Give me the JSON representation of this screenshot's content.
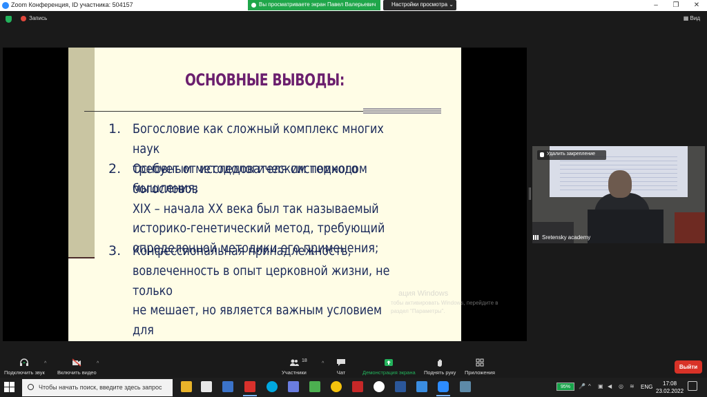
{
  "window": {
    "title": "Zoom Конференция, ID участника: 504157",
    "share_banner": "Вы просматриваете экран Павел Валерьевич",
    "view_options": "Настройки просмотра ⌄",
    "controls": {
      "minimize": "–",
      "restore": "❐",
      "close": "✕"
    }
  },
  "meeting": {
    "recording_label": "Запись",
    "view_label": "Вид"
  },
  "slide": {
    "title": "ОСНОВНЫЕ ВЫВОДЫ:",
    "items": [
      {
        "num": "1.",
        "text": "Богословие как сложный комплекс многих наук\nтребует от исследователя системного мышления;"
      },
      {
        "num": "2.",
        "text": "Основным методологическим подходом богословов\nXIX – начала XX века был так называемый\nисторико-генетический метод, требующий\nопределенной методики его применения;"
      },
      {
        "num": "3.",
        "text": "Конфессиональная принадлежность,\nвовлеченность в опыт церковной жизни, не только\nне мешает, но является важным условием для\nполучения объективных научных результатов."
      }
    ]
  },
  "watermark": {
    "line1": "ация Windows",
    "line2": "тобы активировать Windows, перейдите в\nраздел \"Параметры\"."
  },
  "speaker": {
    "unpin_label": "Удалить закрепление",
    "name": "Sretensky academy"
  },
  "toolbar": {
    "mute": "Подключить звук",
    "video": "Включить видео",
    "participants": "Участники",
    "participants_count": "18",
    "chat": "Чат",
    "share": "Демонстрация экрана",
    "raise_hand": "Поднять руку",
    "apps": "Приложения",
    "leave": "Выйти",
    "caret": "^"
  },
  "taskbar": {
    "search_placeholder": "Чтобы начать поиск, введите здесь запрос",
    "battery": "95%",
    "language": "ENG",
    "time": "17:08",
    "date": "23.02.2022"
  }
}
